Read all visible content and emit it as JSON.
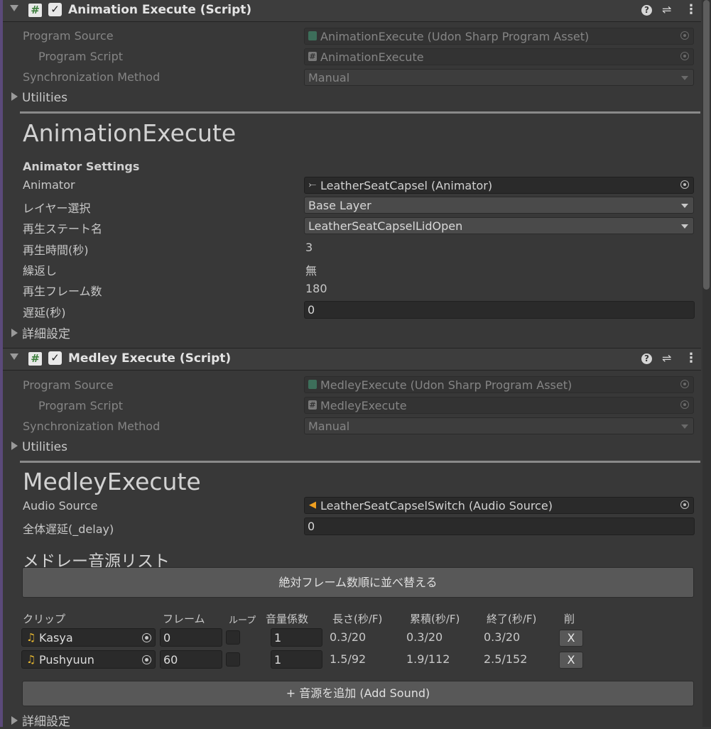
{
  "components": [
    {
      "title": "Animation Execute (Script)",
      "enabled": true,
      "program_source_label": "Program Source",
      "program_source_value": "AnimationExecute (Udon Sharp Program Asset)",
      "program_script_label": "Program Script",
      "program_script_value": "AnimationExecute",
      "sync_label": "Synchronization Method",
      "sync_value": "Manual",
      "utilities_label": "Utilities"
    },
    {
      "title": "Medley Execute (Script)",
      "enabled": true,
      "program_source_label": "Program Source",
      "program_source_value": "MedleyExecute (Udon Sharp Program Asset)",
      "program_script_label": "Program Script",
      "program_script_value": "MedleyExecute",
      "sync_label": "Synchronization Method",
      "sync_value": "Manual",
      "utilities_label": "Utilities"
    }
  ],
  "animation": {
    "heading": "AnimationExecute",
    "section": "Animator Settings",
    "animator_label": "Animator",
    "animator_value": "LeatherSeatCapsel (Animator)",
    "layer_label": "レイヤー選択",
    "layer_value": "Base Layer",
    "state_label": "再生ステート名",
    "state_value": "LeatherSeatCapselLidOpen",
    "duration_label": "再生時間(秒)",
    "duration_value": "3",
    "loop_label": "繰返し",
    "loop_value": "無",
    "frames_label": "再生フレーム数",
    "frames_value": "180",
    "delay_label": "遅延(秒)",
    "delay_value": "0",
    "details_label": "詳細設定"
  },
  "medley": {
    "heading": "MedleyExecute",
    "audio_label": "Audio Source",
    "audio_value": "LeatherSeatCapselSwitch (Audio Source)",
    "delay_label": "全体遅延(_delay)",
    "delay_value": "0",
    "list_title": "メドレー音源リスト",
    "sort_button": "絶対フレーム数順に並べ替える",
    "columns": [
      "クリップ",
      "フレーム",
      "ループ",
      "音量係数",
      "長さ(秒/F)",
      "累積(秒/F)",
      "終了(秒/F)",
      "削"
    ],
    "rows": [
      {
        "clip": "Kasya",
        "frame": "0",
        "loop": false,
        "volume": "1",
        "length": "0.3/20",
        "cumulative": "0.3/20",
        "end": "0.3/20",
        "delete": "X"
      },
      {
        "clip": "Pushyuun",
        "frame": "60",
        "loop": false,
        "volume": "1",
        "length": "1.5/92",
        "cumulative": "1.9/112",
        "end": "2.5/152",
        "delete": "X"
      }
    ],
    "add_button": "+ 音源を追加 (Add Sound)",
    "details_label": "詳細設定"
  },
  "icons": {
    "script": "script-hash-icon",
    "check": "✓",
    "help": "?",
    "preset": "⇌",
    "menu": "⋮",
    "audio_clip": "♫"
  },
  "colors": {
    "background": "#383838",
    "header": "#3d3d3d",
    "field": "#2a2a2a",
    "script_icon": "#3a7d3a",
    "clip_icon": "#e8b830"
  }
}
